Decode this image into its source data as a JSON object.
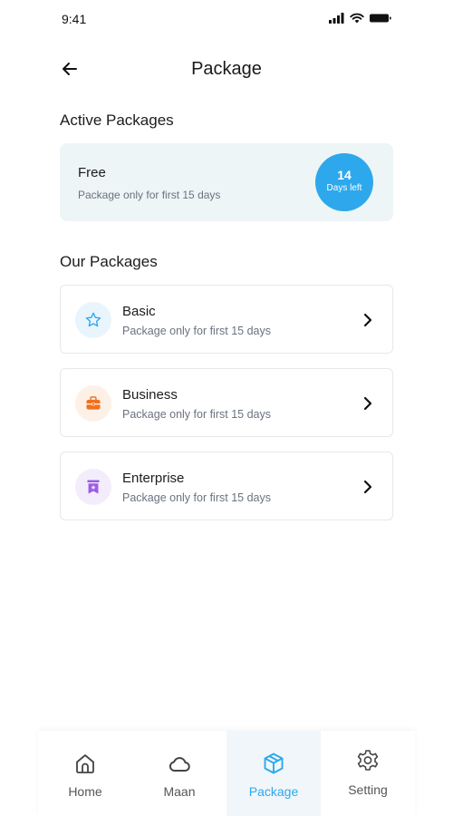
{
  "status_bar": {
    "time": "9:41"
  },
  "header": {
    "title": "Package"
  },
  "active_section": {
    "title": "Active Packages",
    "card": {
      "name": "Free",
      "description": "Package only for first 15 days",
      "days_number": "14",
      "days_label": "Days left",
      "badge_color": "#2ea8ec"
    }
  },
  "packages_section": {
    "title": "Our Packages",
    "items": [
      {
        "name": "Basic",
        "description": "Package only for first 15 days",
        "icon": "star-icon",
        "icon_color": "#2ea8ec",
        "icon_bg": "#e9f5fc"
      },
      {
        "name": "Business",
        "description": "Package only for first 15 days",
        "icon": "briefcase-icon",
        "icon_color": "#f2711c",
        "icon_bg": "#fdf0e7"
      },
      {
        "name": "Enterprise",
        "description": "Package only for first 15 days",
        "icon": "bookmark-icon",
        "icon_color": "#9b5de5",
        "icon_bg": "#f3edfb"
      }
    ]
  },
  "bottom_nav": {
    "items": [
      {
        "label": "Home",
        "icon": "home-icon"
      },
      {
        "label": "Maan",
        "icon": "cloud-icon"
      },
      {
        "label": "Package",
        "icon": "box-icon",
        "active": true
      },
      {
        "label": "Setting",
        "icon": "gear-icon"
      }
    ],
    "active_color": "#2ea8ec"
  }
}
